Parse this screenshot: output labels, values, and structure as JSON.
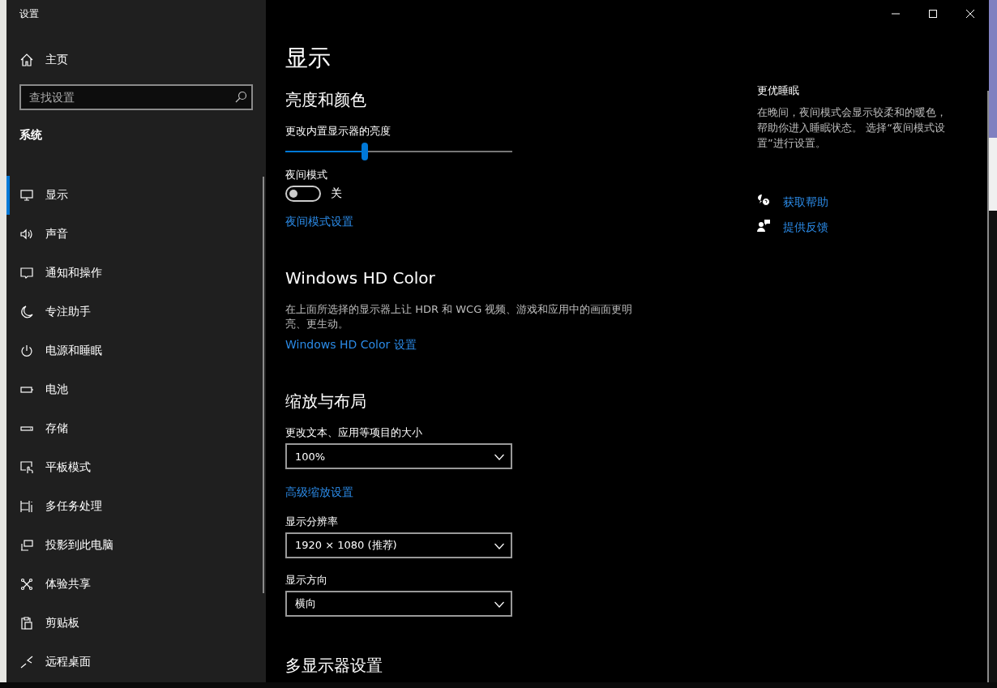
{
  "window": {
    "title": "设置"
  },
  "sidebar": {
    "home": "主页",
    "search": {
      "placeholder": "查找设置"
    },
    "section": "系统",
    "items": [
      {
        "label": "显示",
        "selected": true
      },
      {
        "label": "声音",
        "selected": false
      },
      {
        "label": "通知和操作",
        "selected": false
      },
      {
        "label": "专注助手",
        "selected": false
      },
      {
        "label": "电源和睡眠",
        "selected": false
      },
      {
        "label": "电池",
        "selected": false
      },
      {
        "label": "存储",
        "selected": false
      },
      {
        "label": "平板模式",
        "selected": false
      },
      {
        "label": "多任务处理",
        "selected": false
      },
      {
        "label": "投影到此电脑",
        "selected": false
      },
      {
        "label": "体验共享",
        "selected": false
      },
      {
        "label": "剪贴板",
        "selected": false
      },
      {
        "label": "远程桌面",
        "selected": false
      }
    ]
  },
  "page": {
    "title": "显示",
    "sections": [
      {
        "heading": "亮度和颜色",
        "items": [
          {
            "kind": "slider",
            "label": "更改内置显示器的亮度",
            "level": 0.35
          },
          {
            "kind": "toggle",
            "label": "夜间模式",
            "on": false,
            "state": "关"
          },
          {
            "kind": "link",
            "text": "夜间模式设置"
          }
        ]
      },
      {
        "heading": "Windows HD Color",
        "items": [
          {
            "kind": "text",
            "text": "在上面所选择的显示器上让 HDR 和 WCG 视频、游戏和应用中的画面更明亮、更生动。"
          },
          {
            "kind": "link",
            "text": "Windows HD Color 设置"
          }
        ]
      },
      {
        "heading": "缩放与布局",
        "items": [
          {
            "kind": "dropdown",
            "label": "更改文本、应用等项目的大小",
            "value": "100%"
          },
          {
            "kind": "link",
            "text": "高级缩放设置"
          },
          {
            "kind": "dropdown",
            "label": "显示分辨率",
            "value": "1920 × 1080 (推荐)"
          },
          {
            "kind": "dropdown",
            "label": "显示方向",
            "value": "横向"
          }
        ]
      },
      {
        "heading": "多显示器设置"
      }
    ]
  },
  "related": {
    "heading": "更优睡眠",
    "text": "在晚间，夜间模式会显示较柔和的暖色，帮助你进入睡眠状态。 选择“夜间模式设置”进行设置。",
    "links": [
      "获取帮助",
      "提供反馈"
    ]
  }
}
